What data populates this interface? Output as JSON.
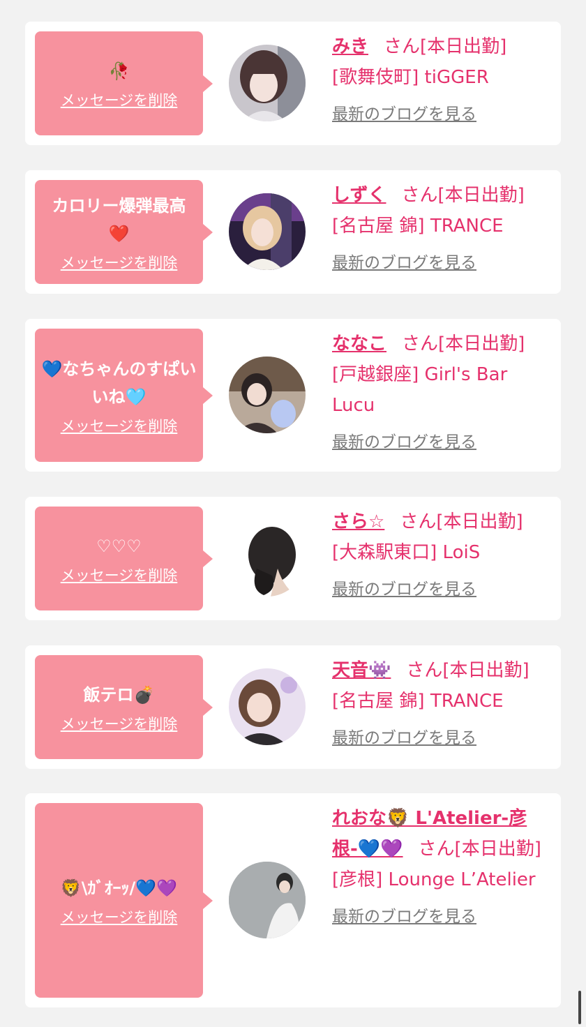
{
  "colors": {
    "page_bg": "#f2f2f2",
    "card_bg": "#ffffff",
    "bubble_bg": "#f7929e",
    "accent_text": "#e5316c",
    "link_gray": "#7a7a7a"
  },
  "labels": {
    "delete_message": "メッセージを削除",
    "view_blog": "最新のブログを見る"
  },
  "items": [
    {
      "message": "🥀",
      "name": "みき",
      "suffix": "さん[本日出勤]",
      "shop": "[歌舞伎町] tiGGER"
    },
    {
      "message": "カロリー爆弾最高❤️",
      "name": "しずく",
      "suffix": "さん[本日出勤]",
      "shop": "[名古屋 錦] TRANCE"
    },
    {
      "message": "💙なちゃんのすぱいいね🩵",
      "name": "ななこ",
      "suffix": "さん[本日出勤]",
      "shop": "[戸越銀座] Girl's Bar Lucu"
    },
    {
      "message": "♡♡♡",
      "name": "さら☆",
      "suffix": "さん[本日出勤]",
      "shop": "[大森駅東口] LoiS"
    },
    {
      "message": "飯テロ💣",
      "name": "天音👾",
      "suffix": "さん[本日出勤]",
      "shop": "[名古屋 錦] TRANCE"
    },
    {
      "message": "🦁\\ｶﾞｵｰｯ/💙💜",
      "name": "れおな🦁 L'Atelier-彦根-💙💜",
      "suffix": "さん[本日出勤]",
      "shop": "[彦根] Lounge L’Atelier"
    }
  ]
}
